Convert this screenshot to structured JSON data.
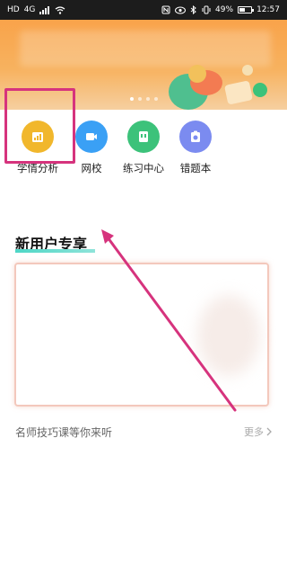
{
  "status_bar": {
    "left_icons": [
      "HD",
      "4G",
      "signal-icon",
      "wifi-icon"
    ],
    "carrier_label": "HD",
    "network_label": "4G",
    "battery_percent": "49%",
    "time": "12:57"
  },
  "banner": {
    "dots_count": 4,
    "active_dot": 0
  },
  "nav": {
    "items": [
      {
        "label": "学情分析",
        "icon": "chart-icon",
        "color": "#f1b72c"
      },
      {
        "label": "网校",
        "icon": "video-icon",
        "color": "#3aa0f5"
      },
      {
        "label": "练习中心",
        "icon": "practice-icon",
        "color": "#3cc27a"
      },
      {
        "label": "错题本",
        "icon": "camera-icon",
        "color": "#7b8bf0"
      }
    ]
  },
  "section": {
    "title": "新用户专享"
  },
  "footer": {
    "text": "名师技巧课等你来听",
    "more_label": "更多"
  },
  "colors": {
    "highlight": "#d6337d",
    "accent": "#4ed6c6"
  }
}
